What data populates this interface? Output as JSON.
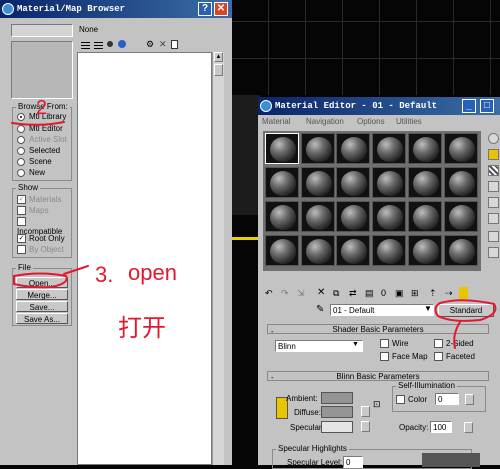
{
  "browser": {
    "title": "Material/Map Browser",
    "none_label": "None",
    "browse_from": {
      "label": "Browse From:",
      "options": [
        {
          "label": "Mtl Library",
          "selected": true,
          "enabled": true
        },
        {
          "label": "Mtl Editor",
          "selected": false,
          "enabled": true
        },
        {
          "label": "Active Slot",
          "selected": false,
          "enabled": false
        },
        {
          "label": "Selected",
          "selected": false,
          "enabled": true
        },
        {
          "label": "Scene",
          "selected": false,
          "enabled": true
        },
        {
          "label": "New",
          "selected": false,
          "enabled": true
        }
      ]
    },
    "show": {
      "label": "Show",
      "options": [
        {
          "label": "Materials",
          "checked": true,
          "enabled": false
        },
        {
          "label": "Maps",
          "checked": false,
          "enabled": false
        },
        {
          "label": "Incompatible",
          "checked": false,
          "enabled": true
        }
      ],
      "root_only": "Root Only",
      "by_object": "By Object"
    },
    "file": {
      "label": "File",
      "buttons": [
        "Open...",
        "Merge...",
        "Save...",
        "Save As..."
      ]
    }
  },
  "editor": {
    "title": "Material Editor - 01 - Default",
    "menu": [
      "Material",
      "Navigation",
      "Options",
      "Utilities"
    ],
    "material_name": "01 - Default",
    "type_button": "Standard",
    "shader_rollout": "Shader Basic Parameters",
    "shader_type": "Blinn",
    "shader_checks": [
      "Wire",
      "2-Sided",
      "Face Map",
      "Faceted"
    ],
    "blinn_rollout": "Blinn Basic Parameters",
    "ambient": "Ambient:",
    "diffuse": "Diffuse:",
    "specular": "Specular:",
    "self_illum": "Self-Illumination",
    "color_label": "Color",
    "color_value": "0",
    "opacity_label": "Opacity:",
    "opacity_value": "100",
    "spec_highlights": "Specular Highlights",
    "spec_level": "Specular Level:",
    "spec_level_value": "0"
  },
  "annotations": {
    "step2": "2",
    "step3": "3.",
    "open_word": "open",
    "chinese": "打开"
  }
}
